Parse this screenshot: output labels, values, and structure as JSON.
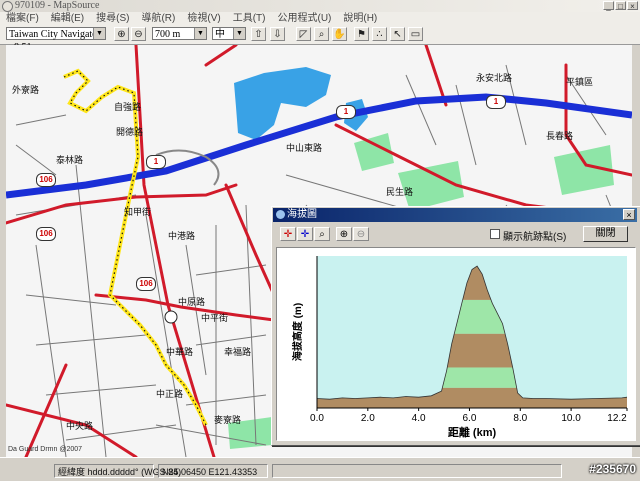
{
  "window": {
    "title": "970109 - MapSource",
    "min_label": "_",
    "max_label": "□",
    "close_label": "×"
  },
  "menu": [
    "檔案(F)",
    "編輯(E)",
    "搜尋(S)",
    "導航(R)",
    "檢視(V)",
    "工具(T)",
    "公用程式(U)",
    "說明(H)"
  ],
  "toolbar": {
    "map_product": "Taiwan City Navigator v8.51",
    "zoom_level": "700 m",
    "detail_level": "中"
  },
  "map": {
    "labels": [
      {
        "t": "自強路"
      },
      {
        "t": "開德路"
      },
      {
        "t": "泰林路"
      },
      {
        "t": "知甲街"
      },
      {
        "t": "中港路"
      },
      {
        "t": "中原路"
      },
      {
        "t": "中平街"
      },
      {
        "t": "中華路"
      },
      {
        "t": "幸福路"
      },
      {
        "t": "中正路"
      },
      {
        "t": "中央路"
      },
      {
        "t": "永安北路"
      },
      {
        "t": "外寮路"
      },
      {
        "t": "長春路"
      },
      {
        "t": "麥寮路"
      },
      {
        "t": "中山東路"
      },
      {
        "t": "民生路"
      },
      {
        "t": "平鎮區"
      }
    ],
    "shields": [
      "106",
      "106",
      "106",
      "1",
      "1",
      "1"
    ],
    "copyright": "Da Guard Drmn @2007"
  },
  "status": {
    "coord_format": "經緯度 hddd.ddddd° (WGS 84)",
    "coords": "N25.06450 E121.43353"
  },
  "watermark": "#235670",
  "profile_window": {
    "title": "海拔圖",
    "close_label": "×",
    "show_points_label": "顯示航跡點(S)",
    "ok_label": "關閉"
  },
  "chart_data": {
    "type": "area",
    "xlabel": "距離 (km)",
    "ylabel": "海拔高度 (m)",
    "xlim": [
      0,
      12.2
    ],
    "xticks": [
      "0.0",
      "2.0",
      "4.0",
      "6.0",
      "8.0",
      "10.0",
      "12.2"
    ],
    "x": [
      0.0,
      0.5,
      1.0,
      1.5,
      2.0,
      2.5,
      3.0,
      3.5,
      4.0,
      4.5,
      4.9,
      5.1,
      5.3,
      5.5,
      5.7,
      5.9,
      6.1,
      6.3,
      6.5,
      6.7,
      6.9,
      7.1,
      7.3,
      7.5,
      7.7,
      7.9,
      8.1,
      8.5,
      9.0,
      10.0,
      11.0,
      12.0,
      12.2
    ],
    "y": [
      14,
      13,
      15,
      14,
      15,
      16,
      15,
      17,
      16,
      18,
      25,
      55,
      95,
      125,
      155,
      185,
      205,
      210,
      198,
      175,
      155,
      140,
      125,
      95,
      60,
      22,
      15,
      14,
      14,
      13,
      14,
      15,
      16
    ],
    "ylim": [
      0,
      225
    ],
    "bands": [
      {
        "from": 0,
        "to": 30,
        "color": "#b08c62"
      },
      {
        "from": 30,
        "to": 60,
        "color": "#9ee6a8"
      },
      {
        "from": 60,
        "to": 110,
        "color": "#b08c62"
      },
      {
        "from": 110,
        "to": 160,
        "color": "#9ee6a8"
      },
      {
        "from": 160,
        "to": 225,
        "color": "#b08c62"
      }
    ],
    "sky_color": "#c9f2f0"
  }
}
